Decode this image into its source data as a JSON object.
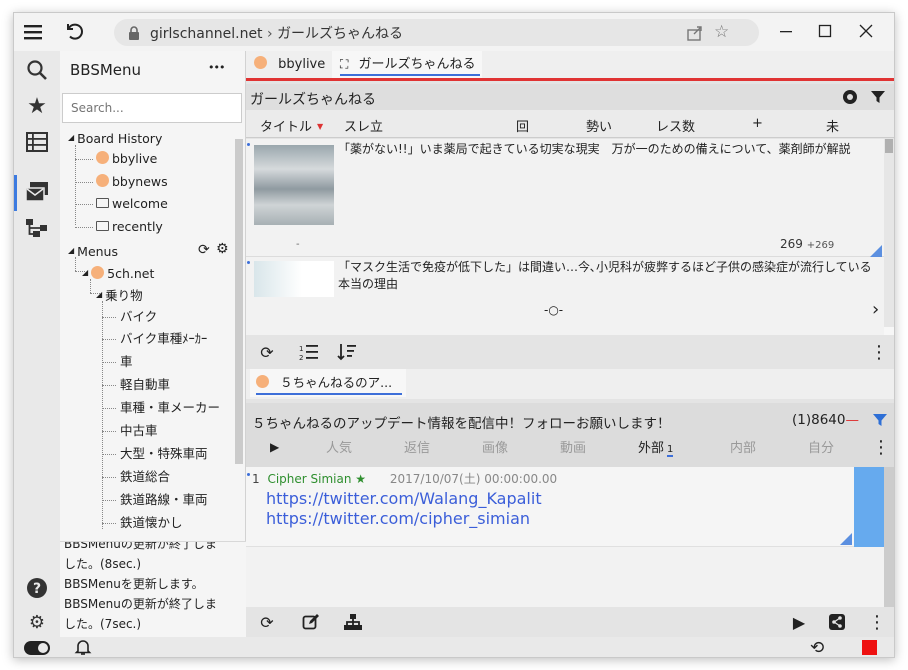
{
  "browser": {
    "url": "girlschannel.net",
    "page_title": "ガールズちゃんねる"
  },
  "left_panel": {
    "title": "BBSMenu",
    "menu_dots": "•••",
    "search_placeholder": "Search...",
    "tree": {
      "board_history_label": "Board History",
      "history_items": [
        "bbylive",
        "bbynews",
        "welcome",
        "recently"
      ],
      "menus_label": "Menus",
      "site_label": "5ch.net",
      "category_label": "乗り物",
      "boards": [
        "バイク",
        "バイク車種ﾒｰｶｰ",
        "車",
        "軽自動車",
        "車種・車メーカー",
        "中古車",
        "大型・特殊車両",
        "鉄道総合",
        "鉄道路線・車両",
        "鉄道懐かし"
      ]
    },
    "log_lines": [
      "BBSMenuの更新が終了しま",
      "した。(8sec.)",
      "BBSMenuを更新します。",
      "BBSMenuの更新が終了しま",
      "した。(7sec.)"
    ]
  },
  "board_tabs": [
    {
      "label": "bbylive"
    },
    {
      "label": "ガールズちゃんねる"
    }
  ],
  "board_header": {
    "title": "ガールズちゃんねる"
  },
  "columns": [
    "タイトル",
    "スレ立",
    "回",
    "勢い",
    "レス数",
    "+",
    "未"
  ],
  "threads": [
    {
      "title": "「薬がない!!」いま薬局で起きている切実な現実　万が一のための備えについて、薬剤師が解説",
      "count": "269",
      "new": "+269",
      "dash": "-"
    },
    {
      "title": "「マスク生活で免疫が低下した」は間違い…今､小児科が疲弊するほど子供の感染症が流行している本当の理由"
    }
  ],
  "thread_tab": {
    "label": "５ちゃんねるのア..."
  },
  "thread_header": {
    "title": "５ちゃんねるのアップデート情報を配信中！フォローお願いします！",
    "count": "(1)8640",
    "filters": [
      "人気",
      "返信",
      "画像",
      "動画",
      "外部",
      "内部",
      "自分"
    ],
    "external_count": "1"
  },
  "posts": [
    {
      "number": "1",
      "name": "Cipher Simian ★",
      "date": "2017/10/07(土) 00:00:00.00",
      "links": [
        "https://twitter.com/Walang_Kapalit",
        "https://twitter.com/cipher_simian"
      ]
    }
  ],
  "colors": {
    "accent_red": "#e03333",
    "link_blue": "#3b5ed9",
    "poster_green": "#2f8f2f",
    "scroll_blue": "#66aaee",
    "stop_red": "#ee1111"
  }
}
